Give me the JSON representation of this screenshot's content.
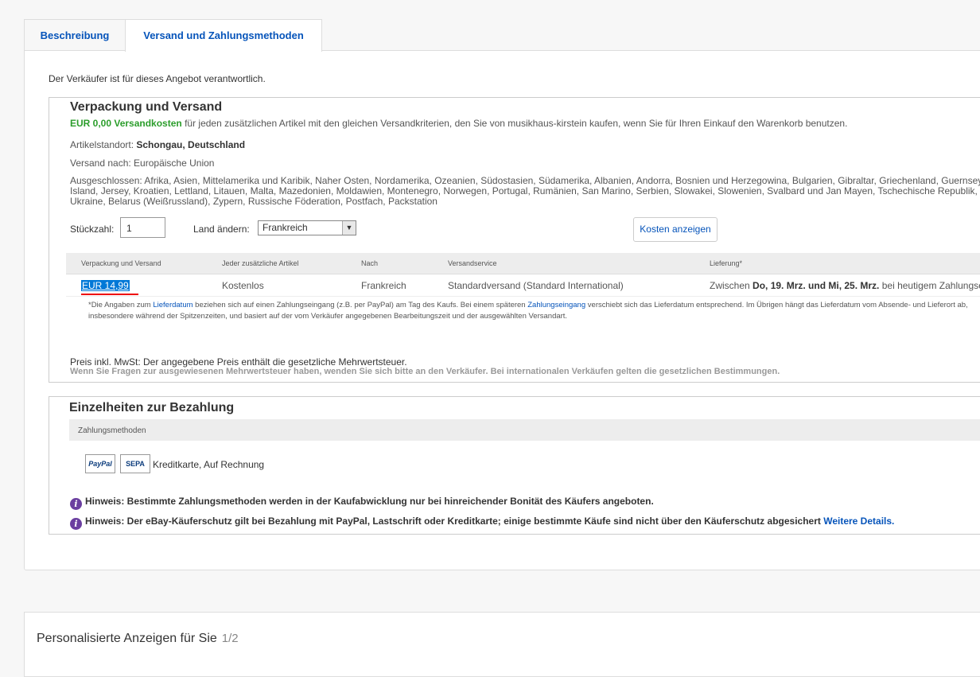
{
  "tabs": [
    {
      "label": "Beschreibung"
    },
    {
      "label": "Versand und Zahlungsmethoden"
    }
  ],
  "seller_note": "Der Verkäufer ist für dieses Angebot verantwortlich.",
  "shipping": {
    "title": "Verpackung und Versand",
    "free_amount": "EUR 0,00 Versandkosten",
    "free_text": " für jeden zusätzlichen Artikel mit den gleichen Versandkriterien, den Sie von musikhaus-kirstein kaufen, wenn Sie für Ihren Einkauf den Warenkorb benutzen.",
    "location_label": "Artikelstandort: ",
    "location_value": "Schongau, Deutschland",
    "ships_to": "Versand nach: Europäische Union",
    "excluded": "Ausgeschlossen: Afrika, Asien, Mittelamerika und Karibik, Naher Osten, Nordamerika, Ozeanien, Südostasien, Südamerika, Albanien, Andorra, Bosnien und Herzegowina, Bulgarien, Gibraltar, Griechenland, Guernsey, Island, Jersey, Kroatien, Lettland, Litauen, Malta, Mazedonien, Moldawien, Montenegro, Norwegen, Portugal, Rumänien, San Marino, Serbien, Slowakei, Slowenien, Svalbard und Jan Mayen, Tschechische Republik, Ukraine, Belarus (Weißrussland), Zypern, Russische Föderation, Postfach, Packstation",
    "qty_label": "Stückzahl:",
    "qty_value": "1",
    "country_label": "Land ändern:",
    "country_value": "Frankreich",
    "cost_button": "Kosten anzeigen",
    "table": {
      "headers": [
        "Verpackung und Versand",
        "Jeder zusätzliche Artikel",
        "Nach",
        "Versandservice",
        "Lieferung*"
      ],
      "row": {
        "price": "EUR 14,99",
        "additional": "Kostenlos",
        "to": "Frankreich",
        "service": "Standardversand (Standard International)",
        "delivery_prefix": "Zwischen ",
        "delivery_dates": "Do, 19. Mrz. und Mi, 25. Mrz.",
        "delivery_suffix": " bei heutigem Zahlungseingang"
      }
    },
    "footnote_1": "*Die Angaben zum ",
    "footnote_link1": "Lieferdatum",
    "footnote_2": " beziehen sich auf einen Zahlungseingang (z.B. per PayPal) am Tag des Kaufs. Bei einem späteren ",
    "footnote_link2": "Zahlungseingang",
    "footnote_3": " verschiebt sich das Lieferdatum entsprechend. Im Übrigen hängt das Lieferdatum vom Absende- und Lieferort ab, insbesondere während der Spitzenzeiten, und basiert auf der vom Verkäufer angegebenen Bearbeitungszeit und der ausgewählten Versandart.",
    "vat_1": "Preis inkl. MwSt: Der angegebene Preis enthält die gesetzliche Mehrwertsteuer.",
    "vat_2": "Wenn Sie Fragen zur ausgewiesenen Mehrwertsteuer haben, wenden Sie sich bitte an den Verkäufer. Bei internationalen Verkäufen gelten die gesetzlichen Bestimmungen."
  },
  "payment": {
    "title": "Einzelheiten zur Bezahlung",
    "header": "Zahlungsmethoden",
    "paypal_logo": "PayPal",
    "sepa_logo": "SEPA",
    "methods_text": "Kreditkarte, Auf Rechnung",
    "note1": "Hinweis: Bestimmte Zahlungsmethoden werden in der Kaufabwicklung nur bei hinreichender Bonität des Käufers angeboten.",
    "note2": "Hinweis: Der eBay-Käuferschutz gilt bei Bezahlung mit PayPal, Lastschrift oder Kreditkarte; einige bestimmte Käufe sind nicht über den Käuferschutz abgesichert ",
    "note2_link": "Weitere Details."
  },
  "ads": {
    "title": "Personalisierte Anzeigen für Sie",
    "page": "1/2"
  },
  "colors": {
    "link": "#0654ba",
    "green": "#2b9d2b",
    "info_icon": "#6b3fa0",
    "selection": "#0078d7"
  },
  "icons": {
    "info": "info-icon",
    "dropdown": "chevron-down-icon"
  }
}
